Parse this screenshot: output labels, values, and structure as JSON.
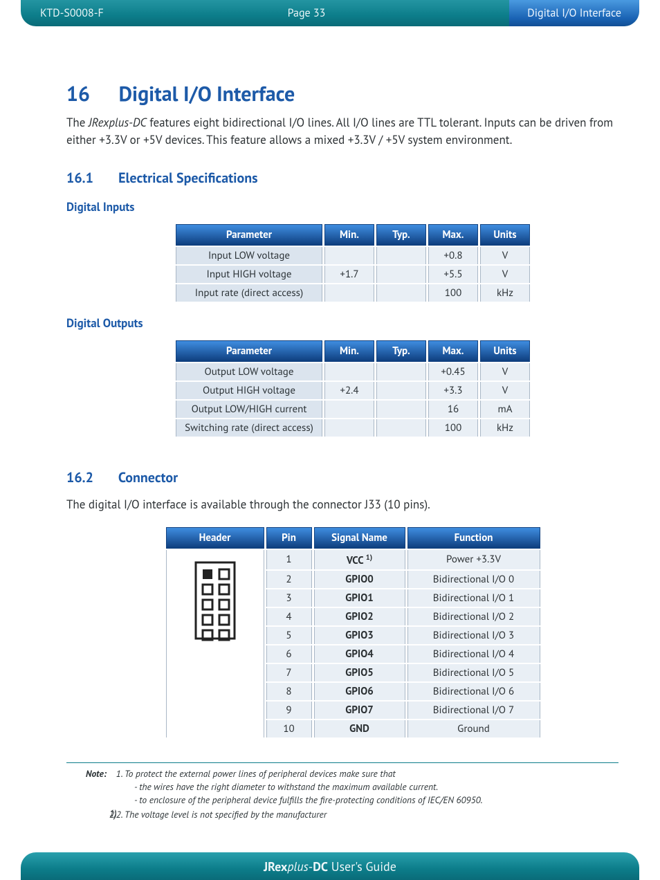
{
  "header": {
    "doc_id": "KTD-S0008-F",
    "page_label": "Page 33",
    "section_label": "Digital I/O Interface"
  },
  "title": {
    "number": "16",
    "text": "Digital I/O Interface"
  },
  "intro_html": "The <em>JRexplus-DC</em> features eight bidirectional I/O lines. All I/O lines are TTL tolerant. Inputs can be driven from either +3.3V or +5V devices. This feature allows a mixed +3.3V / +5V system environment.",
  "sub1": {
    "number": "16.1",
    "text": "Electrical Specifications"
  },
  "inputs_heading": "Digital Inputs",
  "spec_headers": {
    "param": "Parameter",
    "min": "Min.",
    "typ": "Typ.",
    "max": "Max.",
    "units": "Units"
  },
  "inputs_rows": [
    {
      "param": "Input LOW voltage",
      "min": "",
      "typ": "",
      "max": "+0.8",
      "units": "V"
    },
    {
      "param": "Input HIGH voltage",
      "min": "+1.7",
      "typ": "",
      "max": "+5.5",
      "units": "V"
    },
    {
      "param": "Input rate (direct access)",
      "min": "",
      "typ": "",
      "max": "100",
      "units": "kHz"
    }
  ],
  "outputs_heading": "Digital Outputs",
  "outputs_rows": [
    {
      "param": "Output LOW voltage",
      "min": "",
      "typ": "",
      "max": "+0.45",
      "units": "V"
    },
    {
      "param": "Output HIGH voltage",
      "min": "+2.4",
      "typ": "",
      "max": "+3.3",
      "units": "V"
    },
    {
      "param": "Output LOW/HIGH current",
      "min": "",
      "typ": "",
      "max": "16",
      "units": "mA"
    },
    {
      "param": "Switching rate (direct access)",
      "min": "",
      "typ": "",
      "max": "100",
      "units": "kHz"
    }
  ],
  "sub2": {
    "number": "16.2",
    "text": "Connector"
  },
  "connector_intro": "The digital I/O interface is available through the connector J33 (10 pins).",
  "conn_headers": {
    "header": "Header",
    "pin": "Pin",
    "signal": "Signal Name",
    "function": "Function"
  },
  "conn_rows": [
    {
      "pin": "1",
      "signal_html": "VCC <sup>1)</sup>",
      "function": "Power +3.3V"
    },
    {
      "pin": "2",
      "signal_html": "GPIO0",
      "function": "Bidirectional I/O 0"
    },
    {
      "pin": "3",
      "signal_html": "GPIO1",
      "function": "Bidirectional I/O 1"
    },
    {
      "pin": "4",
      "signal_html": "GPIO2",
      "function": "Bidirectional I/O 2"
    },
    {
      "pin": "5",
      "signal_html": "GPIO3",
      "function": "Bidirectional I/O 3"
    },
    {
      "pin": "6",
      "signal_html": "GPIO4",
      "function": "Bidirectional I/O 4"
    },
    {
      "pin": "7",
      "signal_html": "GPIO5",
      "function": "Bidirectional I/O 5"
    },
    {
      "pin": "8",
      "signal_html": "GPIO6",
      "function": "Bidirectional I/O 6"
    },
    {
      "pin": "9",
      "signal_html": "GPIO7",
      "function": "Bidirectional I/O 7"
    },
    {
      "pin": "10",
      "signal_html": "GND",
      "function": "Ground"
    }
  ],
  "notes": {
    "label": "Note:",
    "items": [
      {
        "main": "To protect the external power lines of peripheral devices make sure that",
        "subs": [
          "- the wires have the right diameter to withstand the maximum available current.",
          "- to enclosure of the peripheral device fulfills the fire-protecting conditions of IEC/EN 60950."
        ]
      },
      {
        "main": "The voltage level is not specified by the manufacturer",
        "subs": []
      }
    ]
  },
  "footer_html": "<b>JRex</b><em>plus</em>-<b>DC</b> User's Guide"
}
